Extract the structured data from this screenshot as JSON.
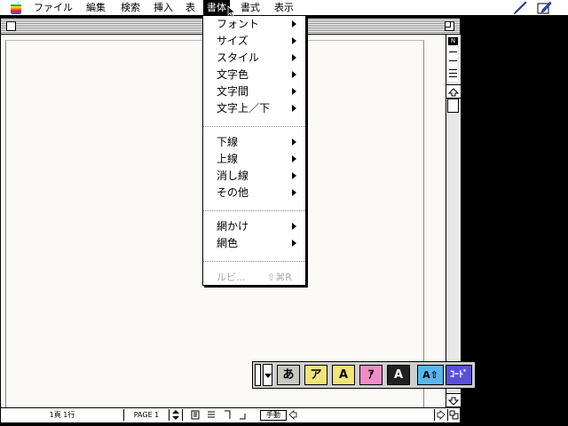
{
  "menubar": {
    "items": [
      "ファイル",
      "編集",
      "検索",
      "挿入",
      "表",
      "書体",
      "書式",
      "表示"
    ],
    "active": "書体"
  },
  "menu": {
    "groups": [
      [
        {
          "label": "フォント"
        },
        {
          "label": "サイズ"
        },
        {
          "label": "スタイル"
        },
        {
          "label": "文字色"
        },
        {
          "label": "文字間"
        },
        {
          "label": "文字上／下"
        }
      ],
      [
        {
          "label": "下線"
        },
        {
          "label": "上線"
        },
        {
          "label": "消し線"
        },
        {
          "label": "その他"
        }
      ],
      [
        {
          "label": "網かけ"
        },
        {
          "label": "網色"
        }
      ]
    ],
    "ruby": {
      "label": "ルビ...",
      "shortcut": "⇧⌘R"
    }
  },
  "ruler_control": {
    "label": "N"
  },
  "status": {
    "position": "1頁 1行",
    "page": "PAGE 1",
    "mode": "手動"
  },
  "ime_palette": {
    "buttons": [
      {
        "label": "あ",
        "color": "#c8c8c0"
      },
      {
        "label": "ア",
        "color": "#f2e27a"
      },
      {
        "label": "A",
        "color": "#f2e27a"
      },
      {
        "label": "ｱ",
        "color": "#f08cc8"
      },
      {
        "label": "A",
        "color": "#202020"
      },
      {
        "label": "A⇧",
        "color": "#5ab4f0"
      },
      {
        "label": "ｺｰﾄﾞ",
        "color": "#5a50d8"
      }
    ]
  }
}
